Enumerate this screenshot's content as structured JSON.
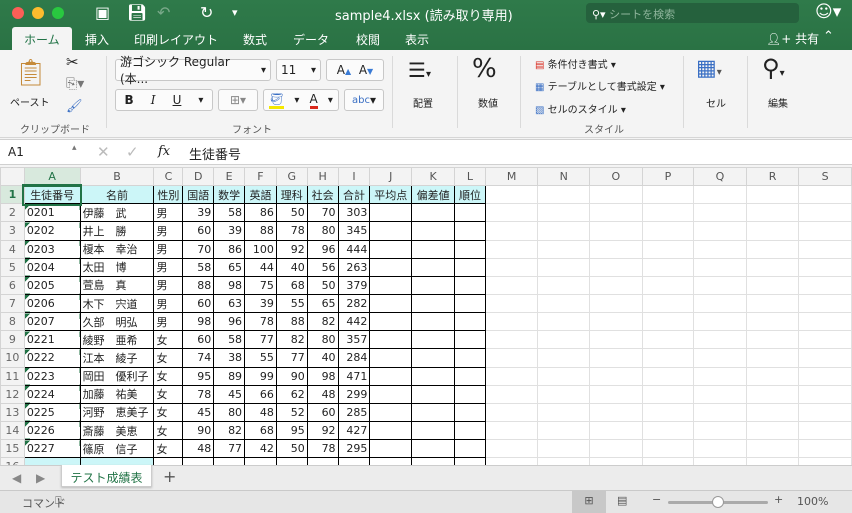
{
  "window": {
    "title": "sample4.xlsx  (読み取り専用)",
    "search_placeholder": "シートを検索"
  },
  "tabs": [
    "ホーム",
    "挿入",
    "印刷レイアウト",
    "数式",
    "データ",
    "校閲",
    "表示"
  ],
  "share_label": "共有",
  "ribbon": {
    "paste": "ペースト",
    "clipboard_group": "クリップボード",
    "font_name": "游ゴシック Regular (本...",
    "font_size": "11",
    "font_group": "フォント",
    "bold": "B",
    "italic": "I",
    "underline": "U",
    "grow": "A",
    "shrink": "A",
    "phonetic": "abc",
    "align": "配置",
    "number_symbol": "%",
    "number": "数値",
    "conditional": "条件付き書式",
    "table_format": "テーブルとして書式設定",
    "cell_style": "セルのスタイル",
    "style_group": "スタイル",
    "cells": "セル",
    "edit": "編集",
    "colors": {
      "highlight": "#f5e800",
      "font_color": "#d9281c",
      "accent": "#217346"
    }
  },
  "formula_bar": {
    "name_box": "A1",
    "fx": "fx",
    "value": "生徒番号"
  },
  "columns": [
    "A",
    "B",
    "C",
    "D",
    "E",
    "F",
    "G",
    "H",
    "I",
    "J",
    "K",
    "L",
    "M",
    "N",
    "O",
    "P",
    "Q",
    "R",
    "S"
  ],
  "headers": [
    "生徒番号",
    "名前",
    "性別",
    "国語",
    "数学",
    "英語",
    "理科",
    "社会",
    "合計",
    "平均点",
    "偏差値",
    "順位"
  ],
  "rows": [
    [
      "0201",
      "伊藤　武",
      "男",
      39,
      58,
      86,
      50,
      70,
      303
    ],
    [
      "0202",
      "井上　勝",
      "男",
      60,
      39,
      88,
      78,
      80,
      345
    ],
    [
      "0203",
      "榎本　幸治",
      "男",
      70,
      86,
      100,
      92,
      96,
      444
    ],
    [
      "0204",
      "太田　博",
      "男",
      58,
      65,
      44,
      40,
      56,
      263
    ],
    [
      "0205",
      "萱島　真",
      "男",
      88,
      98,
      75,
      68,
      50,
      379
    ],
    [
      "0206",
      "木下　宍道",
      "男",
      60,
      63,
      39,
      55,
      65,
      282
    ],
    [
      "0207",
      "久部　明弘",
      "男",
      98,
      96,
      78,
      88,
      82,
      442
    ],
    [
      "0221",
      "綾野　亜希",
      "女",
      60,
      58,
      77,
      82,
      80,
      357
    ],
    [
      "0222",
      "江本　綾子",
      "女",
      74,
      38,
      55,
      77,
      40,
      284
    ],
    [
      "0223",
      "岡田　優利子",
      "女",
      95,
      89,
      99,
      90,
      98,
      471
    ],
    [
      "0224",
      "加藤　祐美",
      "女",
      78,
      45,
      66,
      62,
      48,
      299
    ],
    [
      "0225",
      "河野　恵美子",
      "女",
      45,
      80,
      48,
      52,
      60,
      285
    ],
    [
      "0226",
      "斎藤　美恵",
      "女",
      90,
      82,
      68,
      95,
      92,
      427
    ],
    [
      "0227",
      "篠原　信子",
      "女",
      48,
      77,
      42,
      50,
      78,
      295
    ]
  ],
  "sheet_tab": "テスト成績表",
  "status": {
    "mode": "コマンド",
    "zoom": "100%",
    "zoom_level": 0.5
  }
}
